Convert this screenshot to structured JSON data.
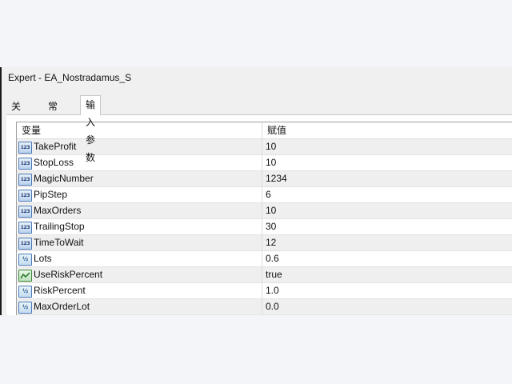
{
  "window": {
    "title": "Expert - EA_Nostradamus_S"
  },
  "tabs": [
    {
      "label": "关于",
      "active": false
    },
    {
      "label": "常用",
      "active": false
    },
    {
      "label": "输入参数",
      "active": true
    }
  ],
  "table": {
    "columns": {
      "variable": "变量",
      "value": "赋值"
    },
    "rows": [
      {
        "icon": "int-icon",
        "name": "TakeProfit",
        "value": "10"
      },
      {
        "icon": "int-icon",
        "name": "StopLoss",
        "value": "10"
      },
      {
        "icon": "int-icon",
        "name": "MagicNumber",
        "value": "1234"
      },
      {
        "icon": "int-icon",
        "name": "PipStep",
        "value": "6"
      },
      {
        "icon": "int-icon",
        "name": "MaxOrders",
        "value": "10"
      },
      {
        "icon": "int-icon",
        "name": "TrailingStop",
        "value": "30"
      },
      {
        "icon": "int-icon",
        "name": "TimeToWait",
        "value": "12"
      },
      {
        "icon": "double-icon",
        "name": "Lots",
        "value": "0.6"
      },
      {
        "icon": "bool-icon",
        "name": "UseRiskPercent",
        "value": "true"
      },
      {
        "icon": "double-icon",
        "name": "RiskPercent",
        "value": "1.0"
      },
      {
        "icon": "double-icon",
        "name": "MaxOrderLot",
        "value": "0.0"
      }
    ]
  },
  "icon_glyphs": {
    "int-icon": "123",
    "double-icon": "½"
  }
}
